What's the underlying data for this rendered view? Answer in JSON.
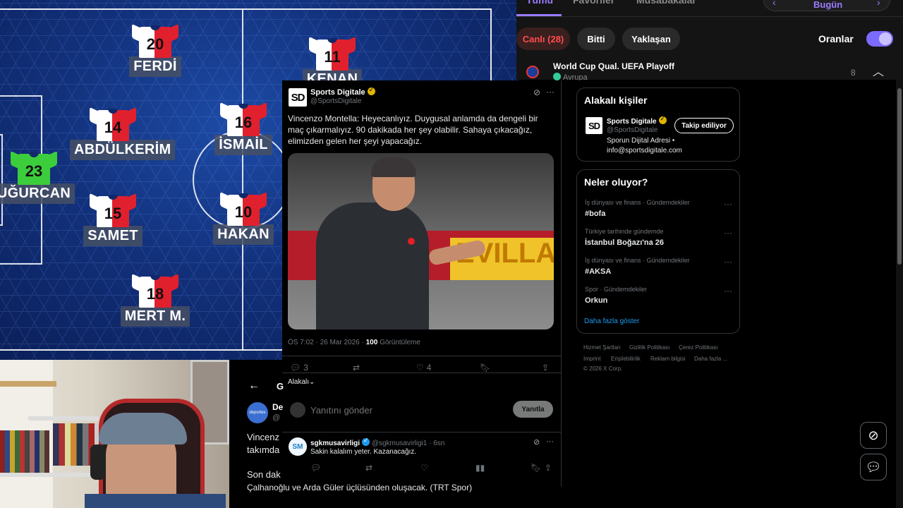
{
  "formation": {
    "players": [
      {
        "number": "20",
        "name": "FERDİ"
      },
      {
        "number": "11",
        "name": "KENAN"
      },
      {
        "number": "14",
        "name": "ABDÜLKERİM"
      },
      {
        "number": "16",
        "name": "İSMAİL"
      },
      {
        "number": "23",
        "name": "UĞURCAN"
      },
      {
        "number": "15",
        "name": "SAMET"
      },
      {
        "number": "10",
        "name": "HAKAN"
      },
      {
        "number": "18",
        "name": "MERT M."
      }
    ]
  },
  "scores": {
    "tabs": [
      "Tümü",
      "Favoriler",
      "Müsabakalar"
    ],
    "date": "Bugün",
    "filters": [
      "Canlı (28)",
      "Bitti",
      "Yaklaşan"
    ],
    "odds_label": "Oranlar",
    "league": "World Cup Qual. UEFA Playoff",
    "region": "Avrupa",
    "count": "8"
  },
  "tweet": {
    "author": "Sports Digitale",
    "handle": "@SportsDigitale",
    "logo": "SD",
    "text": "Vincenzo Montella: Heyecanlıyız. Duygusal anlamda da dengeli bir maç çıkarmalıyız. 90 dakikada her şey olabilir. Sahaya çıkacağız, elimizden gelen her şeyi yapacağız.",
    "banner_text": "EVILLA",
    "meta_time": "ÖS 7:02 · 26 Mar 2026 · ",
    "views_count": "100",
    "views_label": " Görüntüleme",
    "replies": "3",
    "likes": "4",
    "relevance": "Alakalı",
    "reply_placeholder": "Yanıtını gönder",
    "reply_button": "Yanıtla"
  },
  "reply": {
    "author": "sgkmusavirligi",
    "handle": "@sgkmusavirligi1 · 6sn",
    "avatar": "SM",
    "text": "Sakin kalalım yeter. Kazanacağız."
  },
  "sidebar": {
    "people_title": "Alakalı kişiler",
    "person_name": "Sports Digitale",
    "person_handle": "@SportsDigitale",
    "follow_label": "Takip ediliyor",
    "bio_line1": "Sporun Dijital Adresi •",
    "bio_line2": "info@sportsdigitale.com",
    "trends_title": "Neler oluyor?",
    "trends": [
      {
        "category": "İş dünyası ve finans · Gündemdekiler",
        "title": "#bofa"
      },
      {
        "category": "Türkiye tarihinde gündemde",
        "title": "İstanbul Boğazı'na 26"
      },
      {
        "category": "İş dünyası ve finans · Gündemdekiler",
        "title": "#AKSA"
      },
      {
        "category": "Spor · Gündemdekiler",
        "title": "Orkun"
      }
    ],
    "show_more": "Daha fazla göster",
    "footer": [
      "Hizmet Şartları",
      "Gizlilik Politikası",
      "Çerez Politikası",
      "Imprint",
      "Erişilebilirlik",
      "Reklam bilgisi",
      "Daha fazla ...",
      "© 2026 X Corp."
    ]
  },
  "second_tweet": {
    "avatar": "deportes",
    "name": "De",
    "handle": "@",
    "line1": "Vincenz",
    "line2": "takımda",
    "line3": "Son dak",
    "line4": "Çalhanoğlu ve Arda Güler üçlüsünden oluşacak. (TRT Spor)"
  },
  "colors": {
    "accent": "#9b7cff",
    "live": "#ff4d4d",
    "link": "#1d9bf0",
    "shirt_red": "#e1202e",
    "gk_green": "#3ccd3c"
  }
}
